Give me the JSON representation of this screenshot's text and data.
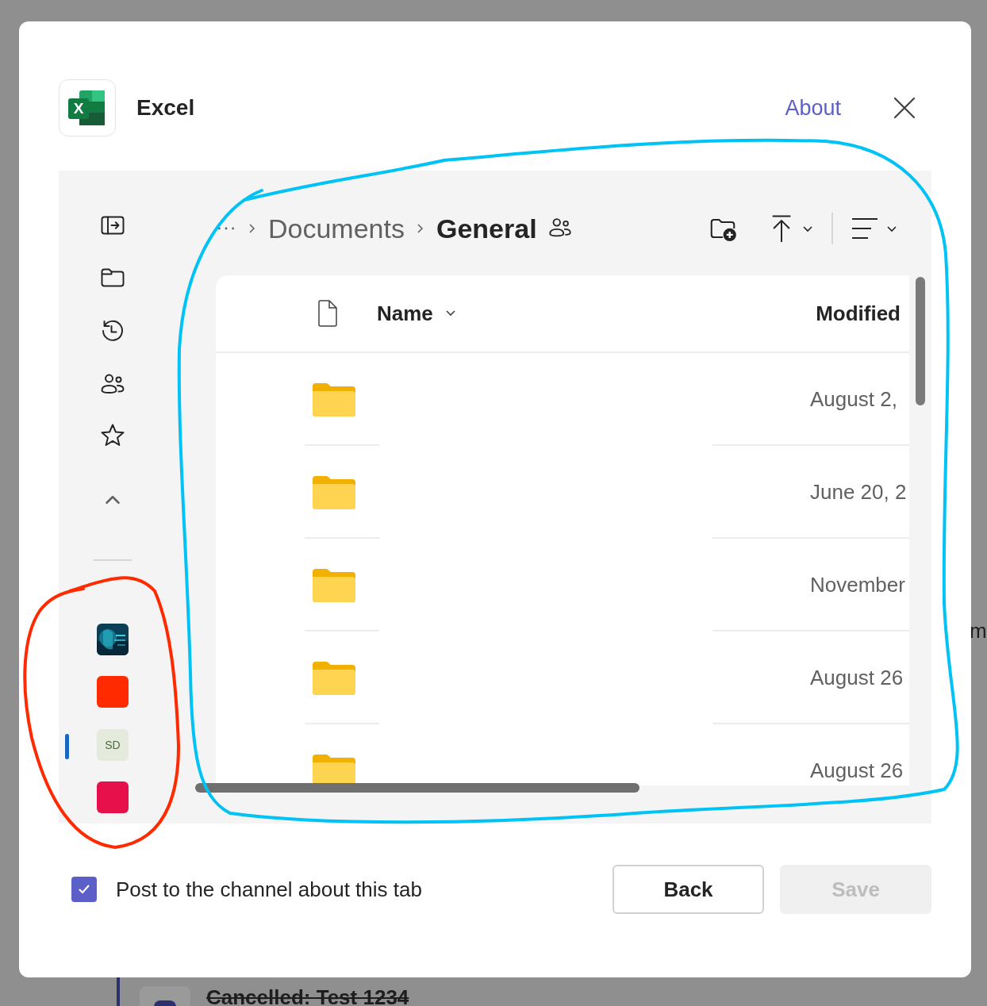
{
  "background": {
    "items": [
      {
        "title": "Cancelled: Test 1234",
        "cancelled": true
      }
    ],
    "cut_text": "m"
  },
  "dialog": {
    "app": {
      "name": "Excel",
      "logo_letter": "X"
    },
    "about_link": "About"
  },
  "rail": {
    "tiles": [
      {
        "kind": "picture",
        "selected": false
      },
      {
        "kind": "color",
        "color": "#ff2a00",
        "selected": false
      },
      {
        "kind": "initials",
        "label": "SD",
        "color": "#e5ebdc",
        "selected": true
      },
      {
        "kind": "color",
        "color": "#e8104a",
        "selected": false
      }
    ]
  },
  "breadcrumb": [
    {
      "label": "Documents",
      "current": false
    },
    {
      "label": "General",
      "current": true
    }
  ],
  "list": {
    "columns": [
      "Name",
      "Modified"
    ],
    "rows": [
      {
        "kind": "folder",
        "modified": "August 2,"
      },
      {
        "kind": "folder",
        "modified": "June 20, 2"
      },
      {
        "kind": "folder",
        "modified": "November"
      },
      {
        "kind": "folder",
        "modified": "August 26"
      },
      {
        "kind": "folder",
        "modified": "August 26"
      }
    ]
  },
  "footer": {
    "post_to_channel": {
      "label": "Post to the channel about this tab",
      "checked": true
    },
    "buttons": [
      {
        "label": "Back",
        "disabled": false
      },
      {
        "label": "Save",
        "disabled": true
      }
    ]
  },
  "annotations": [
    {
      "kind": "loop",
      "color": "#00c3f5"
    },
    {
      "kind": "loop",
      "color": "#ff2a00"
    }
  ]
}
